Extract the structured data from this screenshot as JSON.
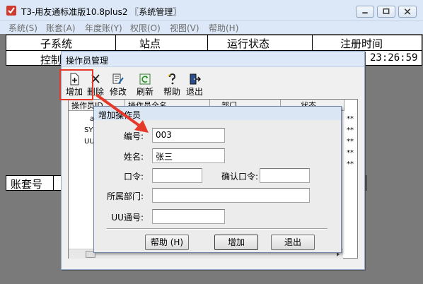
{
  "window": {
    "title": "T3-用友通标准版10.8plus2 〖系统管理〗",
    "icon": "app-logo-icon"
  },
  "menu": [
    "系统(S)",
    "账套(A)",
    "年度账(Y)",
    "权限(O)",
    "视图(V)",
    "帮助(H)"
  ],
  "status_header": {
    "columns": [
      "子系统",
      "站点",
      "运行状态",
      "注册时间"
    ],
    "row": {
      "subsystem": "控制",
      "time": "23:26:59"
    }
  },
  "account_grid": {
    "label": "账套号"
  },
  "operator_window": {
    "title": "操作员管理",
    "toolbar": [
      {
        "label": "增加",
        "icon": "add-doc-icon"
      },
      {
        "label": "删除",
        "icon": "delete-x-icon"
      },
      {
        "label": "修改",
        "icon": "edit-icon"
      },
      {
        "label": "刷新",
        "icon": "refresh-icon"
      },
      {
        "label": "帮助",
        "icon": "help-icon"
      },
      {
        "label": "退出",
        "icon": "exit-icon"
      }
    ],
    "table_cols": [
      "操作员ID",
      "操作员全名",
      "部门",
      "状态"
    ],
    "table_ids": [
      "a",
      "SY",
      "UU",
      "",
      ""
    ],
    "table_tail": [
      "**",
      "**",
      "**",
      "**",
      "**"
    ]
  },
  "dialog": {
    "title": "增加操作员",
    "labels": {
      "code": "编号:",
      "name": "姓名:",
      "password": "口令:",
      "confirm": "确认口令:",
      "dept": "所属部门:",
      "uu": "UU通号:"
    },
    "values": {
      "code": "003",
      "name": "张三",
      "password": "",
      "confirm": "",
      "dept": "",
      "uu": ""
    },
    "buttons": {
      "help": "帮助 (H)",
      "add": "增加",
      "exit": "退出"
    }
  },
  "annotation_color": "#e53a2a"
}
